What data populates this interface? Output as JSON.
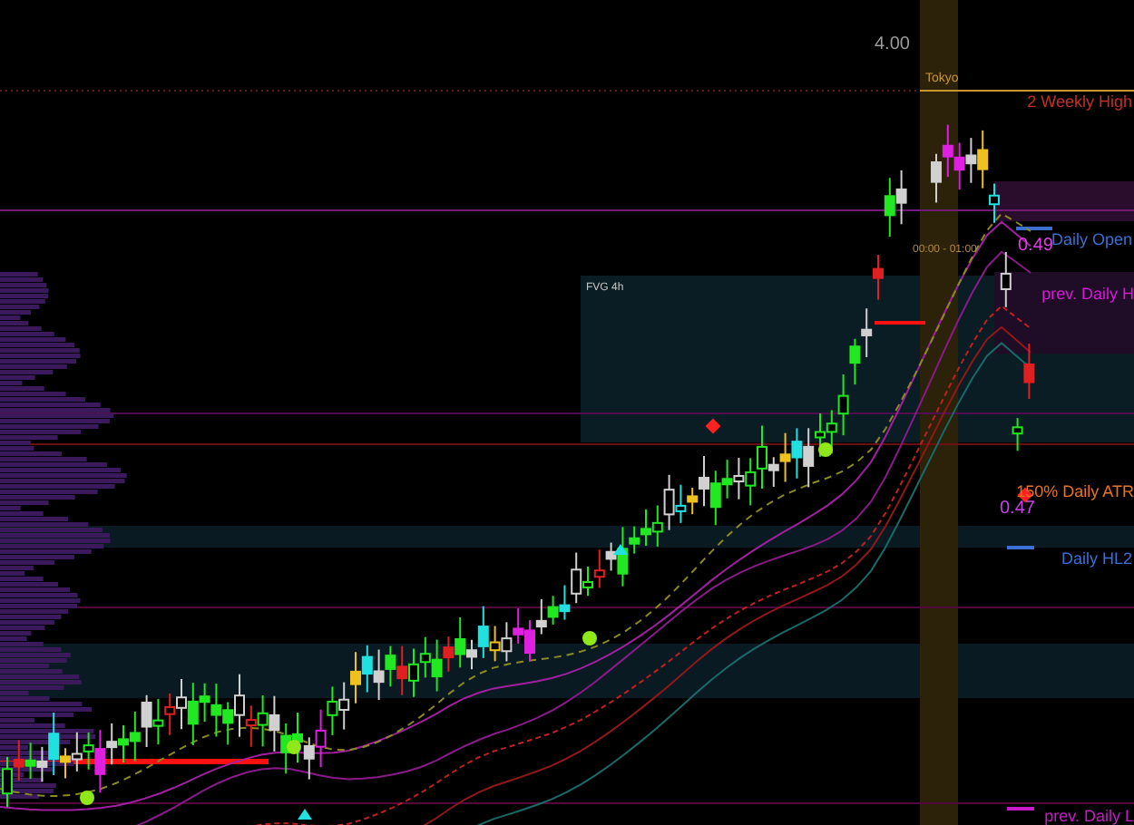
{
  "chart": {
    "labels": [
      {
        "text": "4.00",
        "color": "#9a9a9a"
      },
      {
        "text": "Tokyo",
        "color": "#c8962e"
      },
      {
        "text": "2 Weekly High",
        "color": "#c0302a"
      },
      {
        "text": "00:00 - 01:00",
        "color": "#b08a40"
      },
      {
        "text": "0.49",
        "color": "#e43ce4"
      },
      {
        "text": "Daily Open",
        "color": "#3b6fd0"
      },
      {
        "text": "FVG 4h",
        "color": "#c8c8c8"
      },
      {
        "text": "prev. Daily H",
        "color": "#d41cd4"
      },
      {
        "text": "150% Daily ATR",
        "color": "#e8741c"
      },
      {
        "text": "0.47",
        "color": "#c844e8"
      },
      {
        "text": "Daily HL2",
        "color": "#3a70d8"
      },
      {
        "text": "prev. Daily L",
        "color": "#c81cc8"
      }
    ]
  }
}
